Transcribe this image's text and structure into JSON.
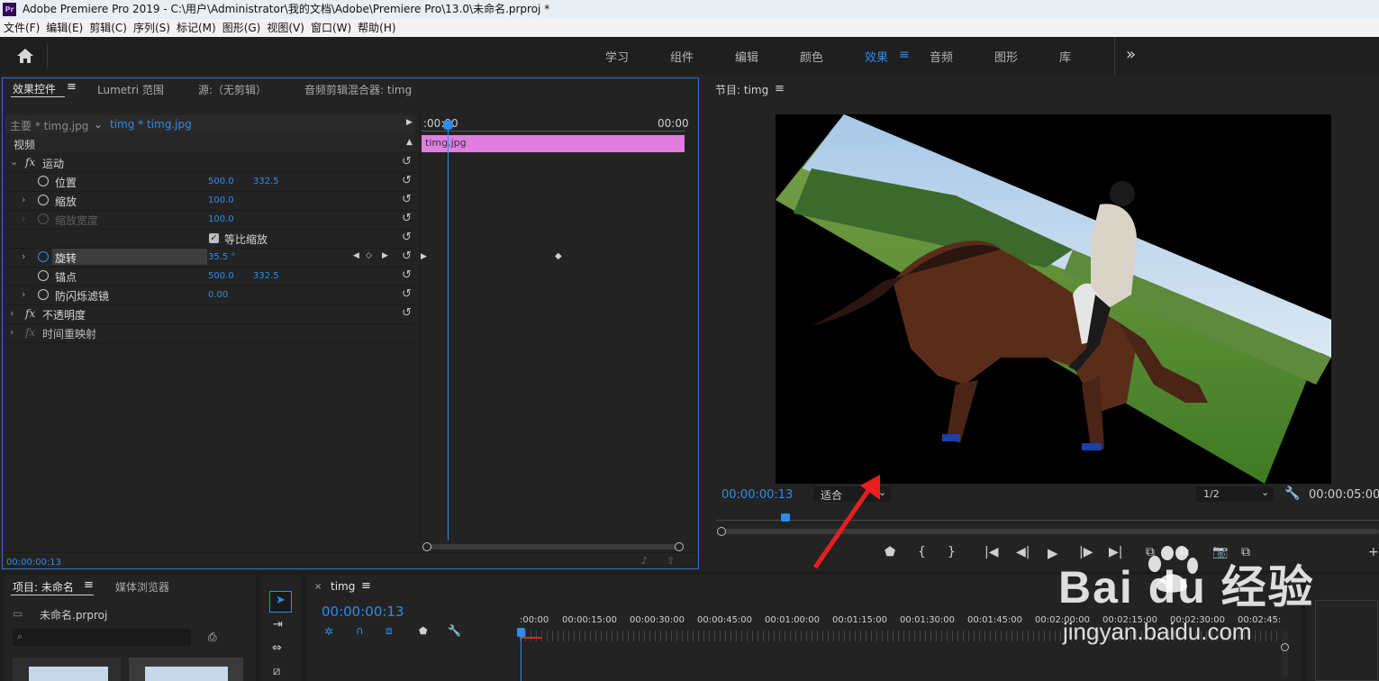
{
  "window": {
    "app_icon": "Pr",
    "title": "Adobe Premiere Pro 2019 - C:\\用户\\Administrator\\我的文档\\Adobe\\Premiere Pro\\13.0\\未命名.prproj *"
  },
  "menu": [
    "文件(F)",
    "编辑(E)",
    "剪辑(C)",
    "序列(S)",
    "标记(M)",
    "图形(G)",
    "视图(V)",
    "窗口(W)",
    "帮助(H)"
  ],
  "workspaces": {
    "items": [
      "学习",
      "组件",
      "编辑",
      "颜色",
      "效果",
      "音频",
      "图形",
      "库"
    ],
    "active": "效果",
    "more": "»"
  },
  "effect_controls": {
    "tabs": [
      "效果控件",
      "Lumetri 范围",
      "源:（无剪辑）",
      "音频剪辑混合器: timg"
    ],
    "master_clip": "主要 * timg.jpg",
    "sequence_clip": "timg * timg.jpg",
    "section_video": "视频",
    "timeline_start": ":00:00",
    "timeline_end": "00:00",
    "clip_label": "timg.jpg",
    "motion": "运动",
    "position_label": "位置",
    "position_x": "500.0",
    "position_y": "332.5",
    "scale_label": "缩放",
    "scale_value": "100.0",
    "scale_width_label": "缩放宽度",
    "scale_width_value": "100.0",
    "uniform_scale_label": "等比缩放",
    "rotation_label": "旋转",
    "rotation_value": "35.5 °",
    "anchor_label": "锚点",
    "anchor_x": "500.0",
    "anchor_y": "332.5",
    "antiflicker_label": "防闪烁滤镜",
    "antiflicker_value": "0.00",
    "opacity_label": "不透明度",
    "time_remap_label": "时间重映射",
    "timecode": "00:00:00:13"
  },
  "program_monitor": {
    "title": "节目: timg",
    "timecode": "00:00:00:13",
    "fit": "适合",
    "resolution": "1/2",
    "duration": "00:00:05:00"
  },
  "project": {
    "tabs": [
      "项目: 未命名",
      "媒体浏览器"
    ],
    "file": "未命名.prproj"
  },
  "timeline": {
    "tab": "timg",
    "timecode": "00:00:00:13",
    "ticks": [
      ":00:00",
      "00:00:15:00",
      "00:00:30:00",
      "00:00:45:00",
      "00:01:00:00",
      "00:01:15:00",
      "00:01:30:00",
      "00:01:45:00",
      "00:02:00:00",
      "00:02:15:00",
      "00:02:30:00",
      "00:02:45:"
    ]
  },
  "watermark": {
    "brand": "Bai du 经验",
    "url": "jingyan.baidu.com"
  },
  "colors": {
    "accent_blue": "#2d8ceb",
    "clip_pink": "#e07ee0",
    "annotation_arrow": "#e81f1f"
  }
}
